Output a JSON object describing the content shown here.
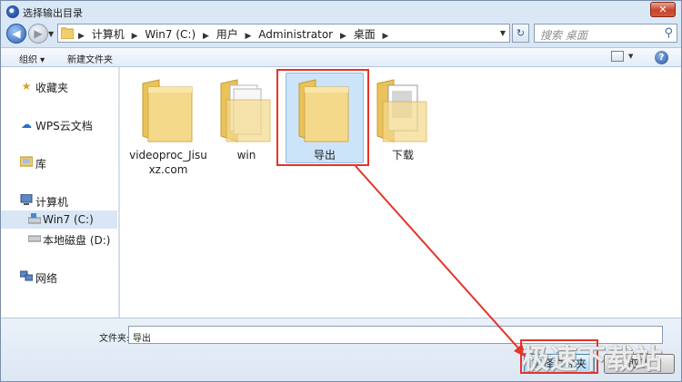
{
  "window": {
    "title": "选择输出目录",
    "close_symbol": "✕"
  },
  "address": {
    "crumbs": [
      "计算机",
      "Win7 (C:)",
      "用户",
      "Administrator",
      "桌面"
    ],
    "search_placeholder": "搜索 桌面"
  },
  "toolbar": {
    "organize_label": "组织 ▾",
    "new_folder_label": "新建文件夹",
    "help_symbol": "?"
  },
  "nav": {
    "items": [
      {
        "label": "收藏夹",
        "icon": "star-icon"
      },
      {
        "label": "WPS云文档",
        "icon": "cloud-icon"
      },
      {
        "label": "库",
        "icon": "library-icon"
      },
      {
        "label": "计算机",
        "icon": "computer-icon"
      },
      {
        "label": "Win7 (C:)",
        "icon": "drive-icon"
      },
      {
        "label": "本地磁盘 (D:)",
        "icon": "drive-icon"
      },
      {
        "label": "网络",
        "icon": "network-icon"
      }
    ]
  },
  "files": [
    {
      "label": "videoproc_Jisuxz.com",
      "icon": "folder-icon"
    },
    {
      "label": "win",
      "icon": "folder-docs-icon"
    },
    {
      "label": "导出",
      "icon": "folder-icon",
      "selected": true
    },
    {
      "label": "下载",
      "icon": "folder-docs-icon"
    }
  ],
  "bottom": {
    "folder_label": "文件夹:",
    "folder_value": "导出",
    "select_button": "选择文件夹",
    "cancel_button": "取消"
  },
  "watermark": "极速下载站",
  "colors": {
    "highlight": "#e5332a",
    "selection": "#cce4fa"
  }
}
